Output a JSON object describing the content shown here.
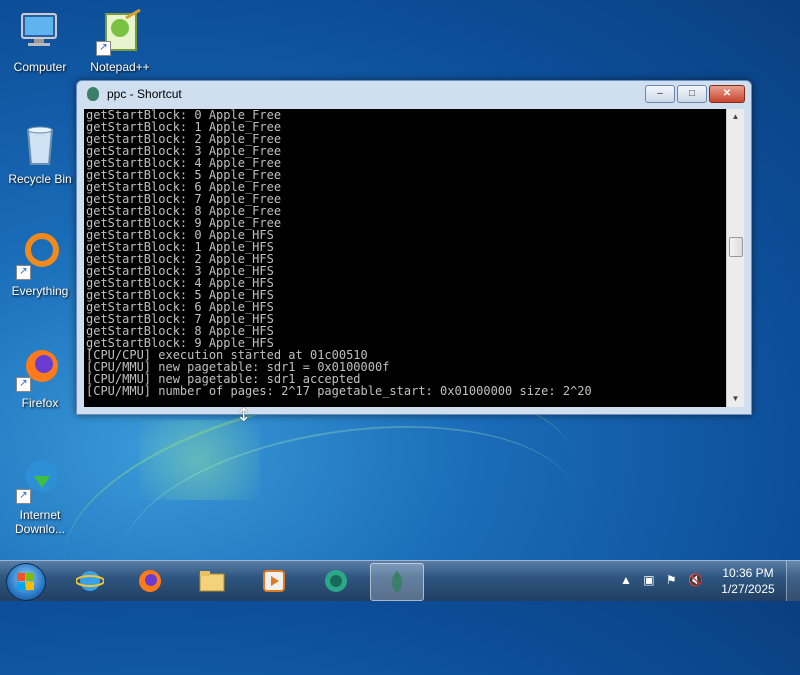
{
  "desktop": {
    "icons": [
      {
        "label": "Computer"
      },
      {
        "label": "Notepad++"
      },
      {
        "label": "Recycle Bin"
      },
      {
        "label": "Everything"
      },
      {
        "label": "Firefox"
      },
      {
        "label": "Internet Downlo..."
      }
    ]
  },
  "window": {
    "title": "ppc - Shortcut",
    "minimize_label": "–",
    "maximize_label": "□",
    "close_label": "✕",
    "console_lines": [
      "getStartBlock: 0 Apple_Free",
      "getStartBlock: 1 Apple_Free",
      "getStartBlock: 2 Apple_Free",
      "getStartBlock: 3 Apple_Free",
      "getStartBlock: 4 Apple_Free",
      "getStartBlock: 5 Apple_Free",
      "getStartBlock: 6 Apple_Free",
      "getStartBlock: 7 Apple_Free",
      "getStartBlock: 8 Apple_Free",
      "getStartBlock: 9 Apple_Free",
      "getStartBlock: 0 Apple_HFS",
      "getStartBlock: 1 Apple_HFS",
      "getStartBlock: 2 Apple_HFS",
      "getStartBlock: 3 Apple_HFS",
      "getStartBlock: 4 Apple_HFS",
      "getStartBlock: 5 Apple_HFS",
      "getStartBlock: 6 Apple_HFS",
      "getStartBlock: 7 Apple_HFS",
      "getStartBlock: 8 Apple_HFS",
      "getStartBlock: 9 Apple_HFS",
      "[CPU/CPU] execution started at 01c00510",
      "[CPU/MMU] new pagetable: sdr1 = 0x0100000f",
      "[CPU/MMU] new pagetable: sdr1 accepted",
      "[CPU/MMU] number of pages: 2^17 pagetable_start: 0x01000000 size: 2^20"
    ]
  },
  "taskbar": {
    "buttons": [
      {
        "icon": "internet-explorer-icon"
      },
      {
        "icon": "firefox-icon"
      },
      {
        "icon": "file-explorer-icon"
      },
      {
        "icon": "media-player-icon"
      },
      {
        "icon": "app-icon"
      },
      {
        "icon": "ppc-icon"
      }
    ],
    "clock_time": "10:36 PM",
    "clock_date": "1/27/2025"
  }
}
